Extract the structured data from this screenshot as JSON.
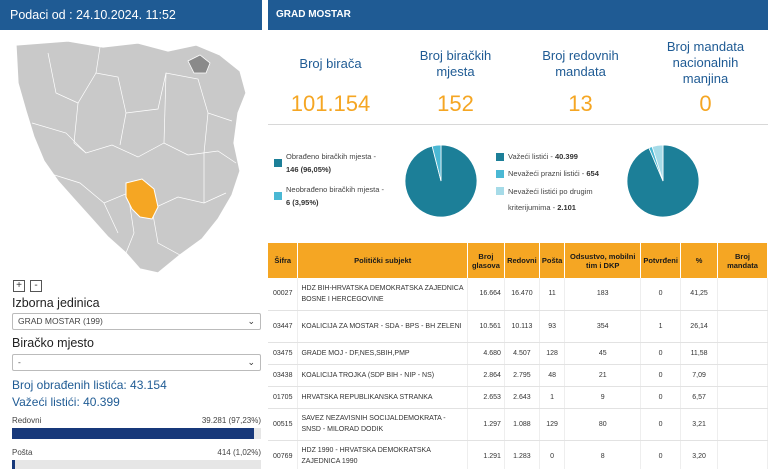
{
  "left": {
    "header": "Podaci od : 24.10.2024. 11:52",
    "zoom_in": "+",
    "zoom_out": "-",
    "izborna_label": "Izborna jedinica",
    "izborna_value": "GRAD MOSTAR (199)",
    "birackomjesto_label": "Biračko mjesto",
    "birackomjesto_value": "-",
    "obradenih": "Broj obrađenih listića: 43.154",
    "vazeci": "Važeći listići: 40.399",
    "redovni_label": "Redovni",
    "redovni_value": "39.281 (97,23%)",
    "redovni_fraction": 0.9723,
    "posta_label": "Pošta",
    "posta_value": "414 (1,02%)",
    "posta_fraction": 0.0102,
    "colors": {
      "header": "#1f5b94",
      "bar": "#17387a",
      "region": "#f5a623",
      "map": "#c9c9c9"
    }
  },
  "right": {
    "header": "GRAD MOSTAR",
    "tiles": [
      {
        "label": "Broj birača",
        "value": "101.154"
      },
      {
        "label": "Broj biračkih mjesta",
        "value": "152"
      },
      {
        "label": "Broj redovnih mandata",
        "value": "13"
      },
      {
        "label": "Broj mandata nacionalnih manjina",
        "value": "0"
      }
    ],
    "legend1": [
      {
        "text": "Obrađeno biračkih mjesta -",
        "bold": "146 (96,05%)",
        "color": "#1c7f98"
      },
      {
        "text": "Neobrađeno biračkih mjesta -",
        "bold": "6 (3,95%)",
        "color": "#4ab8d4"
      }
    ],
    "pie1": [
      {
        "value": 96.05,
        "color": "#1c7f98"
      },
      {
        "value": 3.95,
        "color": "#4ab8d4"
      }
    ],
    "legend2": [
      {
        "text": "Važeći listići -",
        "bold": "40.399",
        "color": "#1c7f98"
      },
      {
        "text": "Nevažeći prazni listići -",
        "bold": "654",
        "color": "#4ab8d4"
      },
      {
        "text": "Nevažeći listići po drugim kriterijumima -",
        "bold": "2.101",
        "color": "#a6dbe8"
      }
    ],
    "pie2": [
      {
        "value": 40399,
        "color": "#1c7f98"
      },
      {
        "value": 654,
        "color": "#4ab8d4"
      },
      {
        "value": 2101,
        "color": "#a6dbe8"
      }
    ],
    "table": {
      "headers": [
        "Šifra",
        "Politički subjekt",
        "Broj glasova",
        "Redovni",
        "Pošta",
        "Odsustvo, mobilni tim i DKP",
        "Potvrđeni",
        "%",
        "Broj mandata"
      ],
      "rows": [
        [
          "00027",
          "HDZ BIH-HRVATSKA DEMOKRATSKA ZAJEDNICA BOSNE I HERCEGOVINE",
          "16.664",
          "16.470",
          "11",
          "183",
          "0",
          "41,25",
          ""
        ],
        [
          "03447",
          "KOALICIJA ZA MOSTAR - SDA - BPS - BH ZELENI",
          "10.561",
          "10.113",
          "93",
          "354",
          "1",
          "26,14",
          ""
        ],
        [
          "03475",
          "GRADE MOJ - DF,NES,SBIH,PMP",
          "4.680",
          "4.507",
          "128",
          "45",
          "0",
          "11,58",
          ""
        ],
        [
          "03438",
          "KOALICIJA TROJKA (SDP BIH - NIP - NS)",
          "2.864",
          "2.795",
          "48",
          "21",
          "0",
          "7,09",
          ""
        ],
        [
          "01705",
          "HRVATSKA REPUBLIKANSKA STRANKA",
          "2.653",
          "2.643",
          "1",
          "9",
          "0",
          "6,57",
          ""
        ],
        [
          "00515",
          "SAVEZ NEZAVISNIH SOCIJALDEMOKRATA - SNSD - MILORAD DODIK",
          "1.297",
          "1.088",
          "129",
          "80",
          "0",
          "3,21",
          ""
        ],
        [
          "00769",
          "HDZ 1990 - HRVATSKA DEMOKRATSKA ZAJEDNICA 1990",
          "1.291",
          "1.283",
          "0",
          "8",
          "0",
          "3,20",
          ""
        ]
      ]
    }
  }
}
